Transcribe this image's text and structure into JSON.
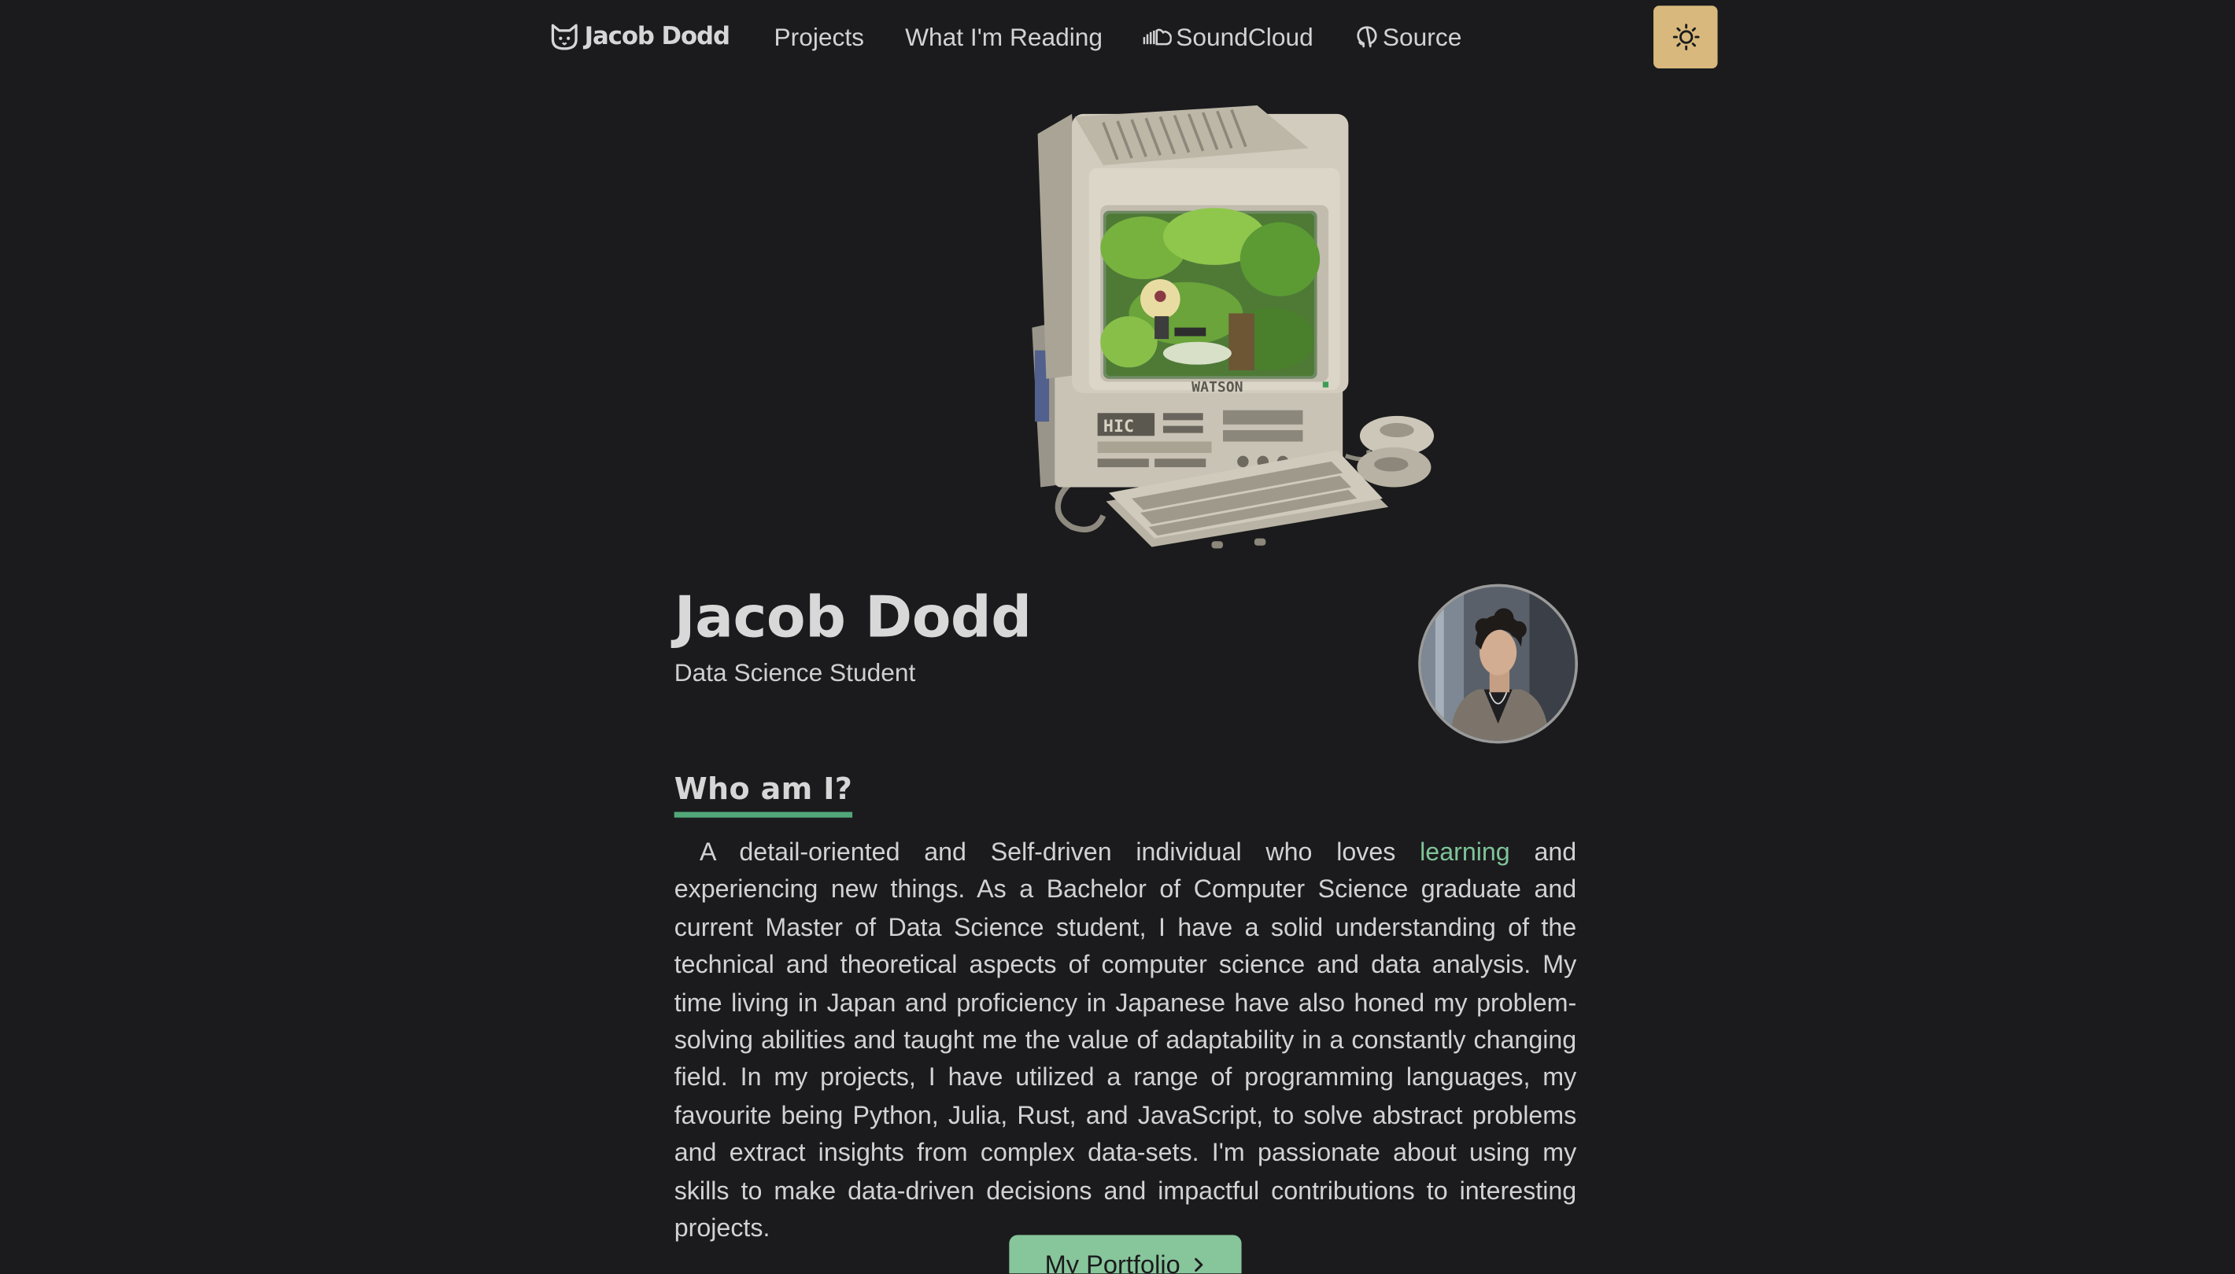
{
  "nav": {
    "brand": "Jacob Dodd",
    "brand_icon": "cat-face-icon",
    "links": [
      {
        "label": "Projects"
      },
      {
        "label": "What I'm Reading"
      },
      {
        "label": "SoundCloud",
        "icon": "soundcloud-icon"
      },
      {
        "label": "Source",
        "icon": "github-icon"
      }
    ],
    "theme_toggle_icon": "sun-icon",
    "theme_toggle_color": "#d8b87c"
  },
  "hero": {
    "illustration": "retro-computer-illustration",
    "monitor_label": "WATSON",
    "case_label": "HIC"
  },
  "profile": {
    "name": "Jacob Dodd",
    "role": "Data Science Student",
    "avatar": "profile-photo"
  },
  "about": {
    "heading": "Who am I?",
    "bio_before": "A detail-oriented and Self-driven individual who loves ",
    "bio_highlight": "learning",
    "bio_after": " and experiencing new things. As a Bachelor of Computer Science graduate and current Master of Data Science student, I have a solid understanding of the technical and theoretical aspects of computer science and data analysis. My time living in Japan and proficiency in Japanese have also honed my problem-solving abilities and taught me the value of adaptability in a constantly changing field. In my projects, I have utilized a range of programming languages, my favourite being Python, Julia, Rust, and JavaScript, to solve abstract problems and extract insights from complex data-sets. I'm passionate about using my skills to make data-driven decisions and impactful contributions to interesting projects.",
    "accent_color": "#52a77a",
    "highlight_color": "#7fc49a"
  },
  "cta": {
    "label": "My Portfolio",
    "icon": "chevron-right-icon",
    "color": "#87c59b"
  },
  "theme": {
    "background": "#1b1b1d",
    "text": "#d2d2d2"
  }
}
